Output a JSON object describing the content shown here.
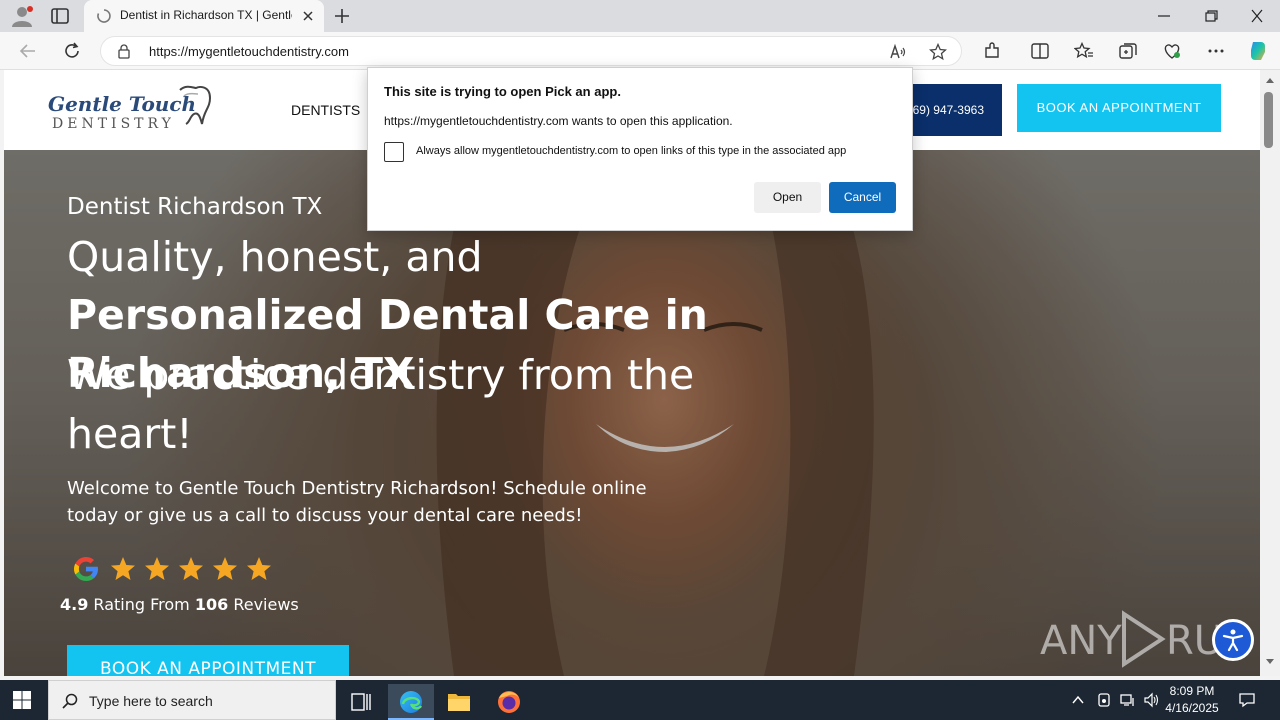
{
  "browser": {
    "tab_title": "Dentist in Richardson TX | Gentle Touch Dentistry",
    "url": "https://mygentletouchdentistry.com"
  },
  "site": {
    "logo": {
      "line1": "Gentle Touch",
      "line2": "DENTISTRY"
    },
    "nav_dentists": "DENTISTS",
    "phone": "(469) 947-3963",
    "book_top": "BOOK AN APPOINTMENT",
    "hero": {
      "subtitle": "Dentist Richardson TX",
      "title_normal": "Quality, honest, and ",
      "title_bold": "Personalized Dental Care in Richardson, TX",
      "tagline": "We practice dentistry from the heart!",
      "welcome": "Welcome to Gentle Touch Dentistry Richardson! Schedule online today or give us a call to discuss your dental care needs!",
      "rating_value": "4.9",
      "rating_mid": " Rating From ",
      "rating_count": "106",
      "rating_end": " Reviews",
      "stars": 5,
      "book": "BOOK AN APPOINTMENT"
    }
  },
  "dialog": {
    "title": "This site is trying to open Pick an app.",
    "message": "https://mygentletouchdentistry.com wants to open this application.",
    "checkbox_label": "Always allow mygentletouchdentistry.com to open links of this type in the associated app",
    "checkbox_checked": false,
    "open_label": "Open",
    "cancel_label": "Cancel"
  },
  "taskbar": {
    "search_placeholder": "Type here to search",
    "time": "8:09 PM",
    "date": "4/16/2025"
  },
  "watermark": "ANY RUN",
  "colors": {
    "accent_cyan": "#14c4f0",
    "navy": "#0a2f6b",
    "dialog_primary": "#0f6cbd",
    "star": "#f5a623"
  }
}
